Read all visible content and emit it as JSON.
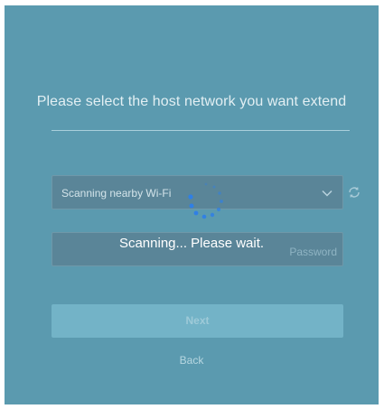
{
  "form": {
    "heading": "Please select the host network you want extend",
    "network_select": {
      "value": "Scanning nearby Wi-Fi"
    },
    "password": {
      "placeholder": "Password"
    },
    "scanning_message": "Scanning... Please wait.",
    "next_label": "Next",
    "back_label": "Back"
  },
  "icons": {
    "select_arrow": "chevron-down-icon",
    "refresh": "refresh-icon",
    "loading": "spinner-icon"
  },
  "colors": {
    "background": "#5b9aaf",
    "input_bg": "#5a8598",
    "button_bg": "#73b3c7",
    "spinner": "#2f7fe6"
  }
}
